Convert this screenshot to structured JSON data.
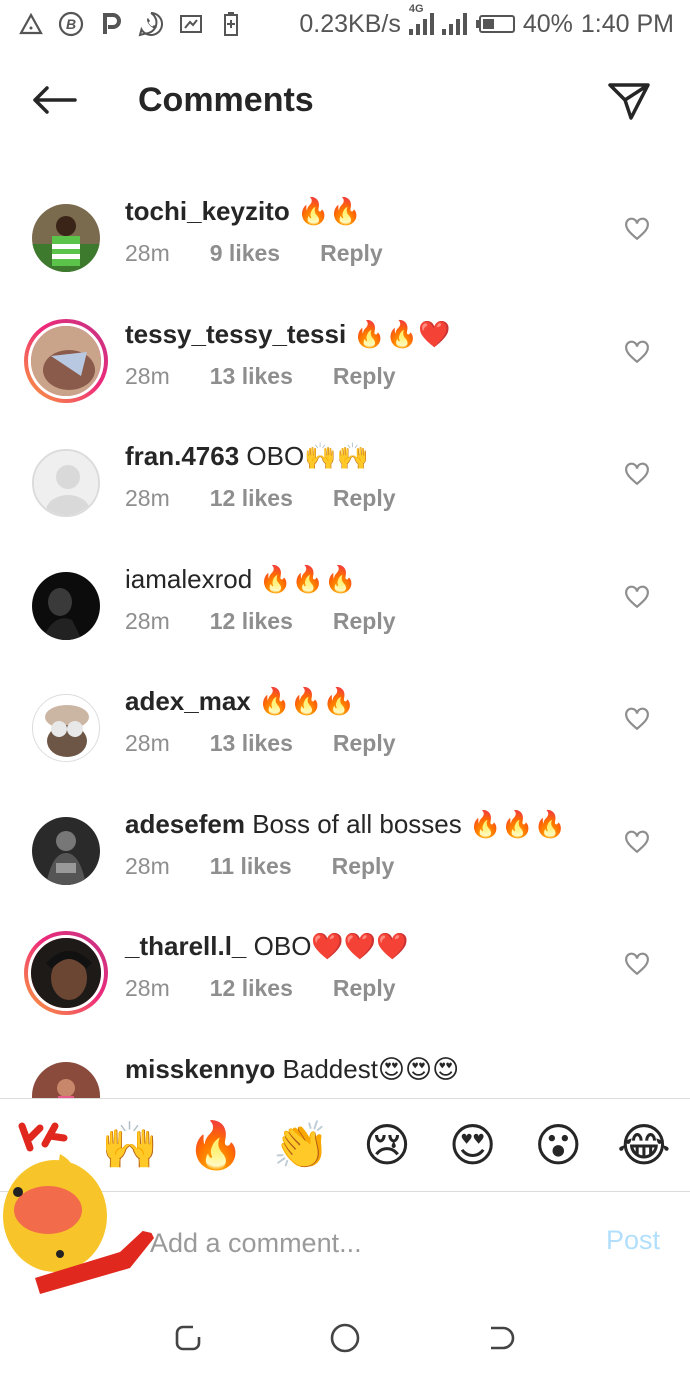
{
  "status_bar": {
    "speed": "0.23KB/s",
    "network": "4G",
    "battery": "40%",
    "time": "1:40 PM",
    "left_icons": [
      "warning-icon",
      "bitcoin-icon",
      "paypal-icon",
      "whatsapp-icon",
      "screenshot-icon",
      "battery-saver-icon"
    ]
  },
  "header": {
    "title": "Comments"
  },
  "comments": [
    {
      "username": "tochi_keyzito",
      "text": " 🔥🔥",
      "time": "28m",
      "likes": "9 likes",
      "reply": "Reply",
      "story_ring": false
    },
    {
      "username": "tessy_tessy_tessi",
      "text": " 🔥🔥❤️",
      "time": "28m",
      "likes": "13 likes",
      "reply": "Reply",
      "story_ring": true
    },
    {
      "username": "fran.4763",
      "text": " OBO🙌🙌",
      "time": "28m",
      "likes": "12 likes",
      "reply": "Reply",
      "story_ring": false
    },
    {
      "username": "iamalexrod",
      "text": " 🔥🔥🔥",
      "time": "28m",
      "likes": "12 likes",
      "reply": "Reply",
      "story_ring": false
    },
    {
      "username": "adex_max",
      "text": " 🔥🔥🔥",
      "time": "28m",
      "likes": "13 likes",
      "reply": "Reply",
      "story_ring": false
    },
    {
      "username": "adesefem",
      "text": " Boss of all bosses 🔥🔥🔥",
      "time": "28m",
      "likes": "11 likes",
      "reply": "Reply",
      "story_ring": false
    },
    {
      "username": "_tharell.l_",
      "text": " OBO❤️❤️❤️",
      "time": "28m",
      "likes": "12 likes",
      "reply": "Reply",
      "story_ring": true
    },
    {
      "username": "misskennyo",
      "text": " Baddest😍😍😍",
      "time": "",
      "likes": "",
      "reply": "",
      "story_ring": false
    }
  ],
  "emoji_bar": [
    "🙌",
    "🔥",
    "👏",
    "😢",
    "😍",
    "😮",
    "😂"
  ],
  "composer": {
    "placeholder": "Add a comment...",
    "post_label": "Post"
  },
  "colors": {
    "text": "#262626",
    "secondary": "#8e8e8e",
    "post_disabled": "#b2dffc",
    "story_ring_start": "#f9a13a",
    "story_ring_end": "#c13584"
  }
}
